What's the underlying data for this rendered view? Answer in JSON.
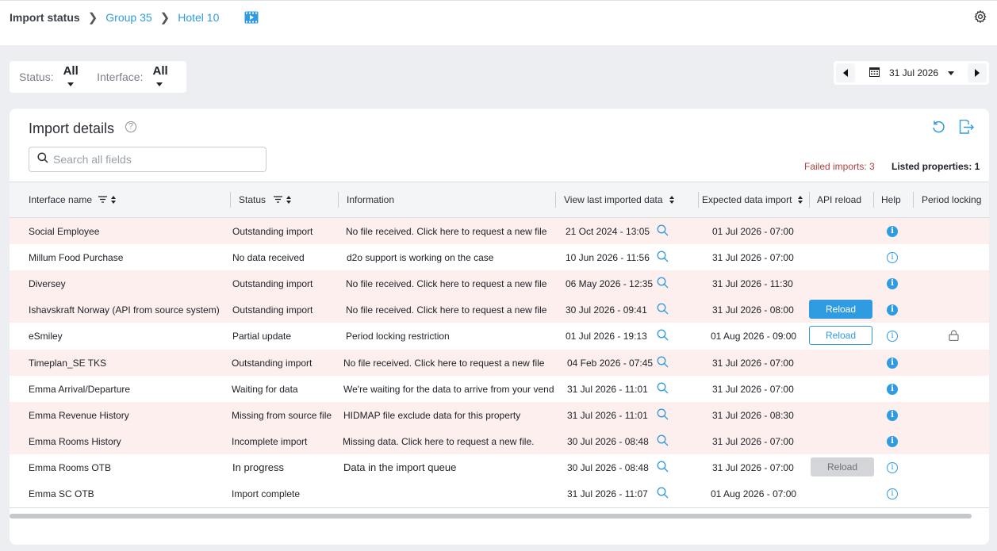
{
  "breadcrumb": {
    "root": "Import status",
    "group": "Group 35",
    "hotel": "Hotel 10"
  },
  "filters": {
    "status_label": "Status:",
    "status_value": "All",
    "interface_label": "Interface:",
    "interface_value": "All"
  },
  "date_picker": {
    "value": "31 Jul 2026"
  },
  "card": {
    "title": "Import details",
    "help_glyph": "?",
    "search_placeholder": "Search all fields",
    "failed_imports": "Failed imports: 3",
    "listed_properties": "Listed properties: 1"
  },
  "columns": {
    "interface_name": "Interface name",
    "status": "Status",
    "information": "Information",
    "view_last": "View last imported data",
    "expected": "Expected data import",
    "api_reload": "API reload",
    "help": "Help",
    "period_locking": "Period locking"
  },
  "rows": [
    {
      "name": "Social Employee",
      "status": "Outstanding import",
      "info": "No file received. Click here to request a new file",
      "last": "21 Oct 2024 - 13:05",
      "expected": "01 Jul 2026 - 07:00",
      "reload": "",
      "help": "solid",
      "lock": false,
      "highlight": true
    },
    {
      "name": "Millum Food Purchase",
      "status": "No data received",
      "info": "d2o support is working on the case",
      "last": "10 Jun 2026 - 11:56",
      "expected": "31 Jul 2026 - 07:00",
      "reload": "",
      "help": "outline",
      "lock": false,
      "highlight": false
    },
    {
      "name": "Diversey",
      "status": "Outstanding import",
      "info": "No file received. Click here to request a new file",
      "last": "06 May 2026 - 12:35",
      "expected": "31 Jul 2026 - 11:30",
      "reload": "",
      "help": "solid",
      "lock": false,
      "highlight": true
    },
    {
      "name": "Ishavskraft Norway (API from source system)",
      "status": "Outstanding import",
      "info": "No file received. Click here to request a new file",
      "last": "30 Jul 2026 - 09:41",
      "expected": "31 Jul 2026 - 08:00",
      "reload": "Reload",
      "reload_style": "primary",
      "help": "solid",
      "lock": false,
      "highlight": true
    },
    {
      "name": "eSmiley",
      "status": "Partial update",
      "info": "Period locking restriction",
      "last": "01 Jul 2026 - 19:13",
      "expected": "01 Aug 2026 - 09:00",
      "reload": "Reload",
      "reload_style": "outline",
      "help": "outline",
      "lock": true,
      "highlight": false
    },
    {
      "name": "Timeplan_SE TKS",
      "status": "Outstanding import",
      "info": "No file received. Click here to request a new file",
      "last": "04 Feb 2026 - 07:45",
      "expected": "31 Jul 2026 - 07:00",
      "reload": "",
      "help": "solid",
      "lock": false,
      "highlight": true
    },
    {
      "name": "Emma Arrival/Departure",
      "status": "Waiting for data",
      "info": "We're waiting for the data to arrive from your vend",
      "last": "31 Jul 2026 - 11:01",
      "expected": "31 Jul 2026 - 07:00",
      "reload": "",
      "help": "solid",
      "lock": false,
      "highlight": false
    },
    {
      "name": "Emma Revenue History",
      "status": "Missing from source file",
      "info": "HIDMAP file exclude data for this property",
      "last": "31 Jul 2026 - 11:01",
      "expected": "31 Jul 2026 - 08:30",
      "reload": "",
      "help": "solid",
      "lock": false,
      "highlight": true
    },
    {
      "name": "Emma Rooms History",
      "status": "Incomplete import",
      "info": "Missing data. Click here to request a new file.",
      "last": "30 Jul 2026 - 08:48",
      "expected": "31 Jul 2026 - 07:00",
      "reload": "",
      "help": "solid",
      "lock": false,
      "highlight": true
    },
    {
      "name": "Emma Rooms OTB",
      "status": "In progress",
      "info": "Data in the import queue",
      "last": "30 Jul 2026 - 08:48",
      "expected": "31 Jul 2026 - 07:00",
      "reload": "Reload",
      "reload_style": "disabled",
      "help": "outline",
      "lock": false,
      "highlight": false
    },
    {
      "name": "Emma SC OTB",
      "status": "Import complete",
      "info": "",
      "last": "31 Jul 2026 - 11:07",
      "expected": "01 Aug 2026 - 07:00",
      "reload": "",
      "help": "outline",
      "lock": false,
      "highlight": false
    }
  ],
  "colors": {
    "accent": "#2f9be0",
    "failed_text": "#b0413e",
    "highlight_row": "#fcefed"
  }
}
